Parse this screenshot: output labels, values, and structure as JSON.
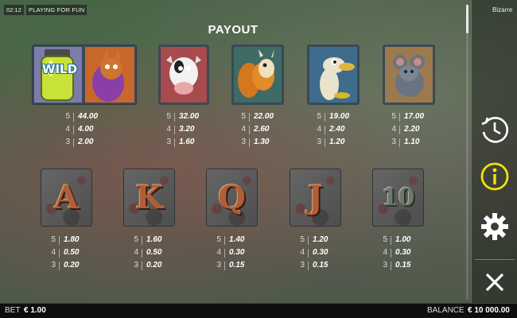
{
  "status": {
    "time": "02:12",
    "mode": "PLAYING FOR FUN",
    "game": "Bizarre"
  },
  "title": "PAYOUT",
  "premium_symbols": [
    {
      "name": "wild-jar",
      "label": "WILD",
      "pays": [
        {
          "count": "5",
          "value": "44.00"
        },
        {
          "count": "4",
          "value": "4.00"
        },
        {
          "count": "3",
          "value": "2.00"
        }
      ]
    },
    {
      "name": "cow",
      "pays": [
        {
          "count": "5",
          "value": "32.00"
        },
        {
          "count": "4",
          "value": "3.20"
        },
        {
          "count": "3",
          "value": "1.60"
        }
      ]
    },
    {
      "name": "squirrel-goat",
      "pays": [
        {
          "count": "5",
          "value": "22.00"
        },
        {
          "count": "4",
          "value": "2.60"
        },
        {
          "count": "3",
          "value": "1.30"
        }
      ]
    },
    {
      "name": "duck",
      "pays": [
        {
          "count": "5",
          "value": "19.00"
        },
        {
          "count": "4",
          "value": "2.40"
        },
        {
          "count": "3",
          "value": "1.20"
        }
      ]
    },
    {
      "name": "mouse",
      "pays": [
        {
          "count": "5",
          "value": "17.00"
        },
        {
          "count": "4",
          "value": "2.20"
        },
        {
          "count": "3",
          "value": "1.10"
        }
      ]
    }
  ],
  "card_symbols": [
    {
      "letter": "A",
      "pays": [
        {
          "count": "5",
          "value": "1.80"
        },
        {
          "count": "4",
          "value": "0.50"
        },
        {
          "count": "3",
          "value": "0.20"
        }
      ]
    },
    {
      "letter": "K",
      "pays": [
        {
          "count": "5",
          "value": "1.60"
        },
        {
          "count": "4",
          "value": "0.50"
        },
        {
          "count": "3",
          "value": "0.20"
        }
      ]
    },
    {
      "letter": "Q",
      "pays": [
        {
          "count": "5",
          "value": "1.40"
        },
        {
          "count": "4",
          "value": "0.30"
        },
        {
          "count": "3",
          "value": "0.15"
        }
      ]
    },
    {
      "letter": "J",
      "pays": [
        {
          "count": "5",
          "value": "1.20"
        },
        {
          "count": "4",
          "value": "0.30"
        },
        {
          "count": "3",
          "value": "0.15"
        }
      ]
    },
    {
      "letter": "10",
      "pays": [
        {
          "count": "5",
          "value": "1.00"
        },
        {
          "count": "4",
          "value": "0.30"
        },
        {
          "count": "3",
          "value": "0.15"
        }
      ]
    }
  ],
  "side_panel": {
    "history_icon": "history-icon",
    "info_icon": "info-icon",
    "settings_icon": "gear-icon",
    "close_icon": "close-icon",
    "info_color": "#f2e400"
  },
  "footer": {
    "bet_label": "BET",
    "bet_value": "€ 1.00",
    "balance_label": "BALANCE",
    "balance_value": "€ 10 000.00"
  }
}
